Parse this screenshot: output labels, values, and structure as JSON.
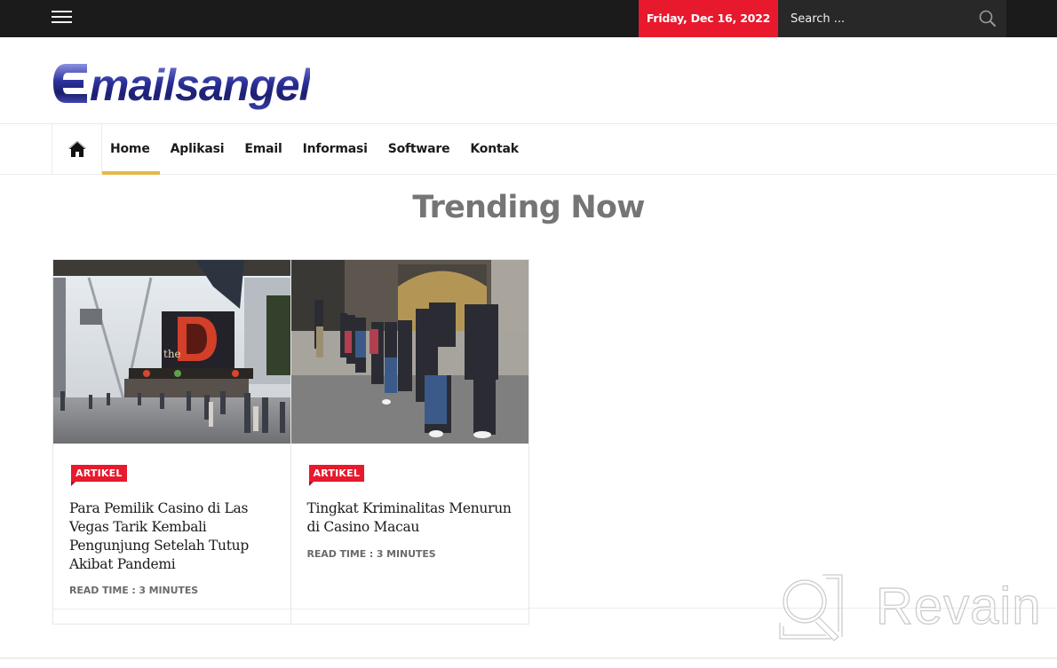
{
  "topbar": {
    "menu_icon": "hamburger-menu-icon",
    "date": "Friday, Dec 16, 2022",
    "search": {
      "placeholder": "Search ...",
      "value": "",
      "icon": "search-icon"
    },
    "colors": {
      "bar": "#1b1b1b",
      "date_bg": "#e8192c",
      "search_bg": "#282828"
    }
  },
  "header": {
    "logo_letter": "E",
    "logo_text": "mailsangel"
  },
  "nav": {
    "home_icon": "home-icon",
    "items": [
      {
        "label": "Home",
        "active": true
      },
      {
        "label": "Aplikasi",
        "active": false
      },
      {
        "label": "Email",
        "active": false
      },
      {
        "label": "Informasi",
        "active": false
      },
      {
        "label": "Software",
        "active": false
      },
      {
        "label": "Kontak",
        "active": false
      }
    ],
    "active_color": "#e5b94a"
  },
  "main": {
    "section_title": "Trending Now",
    "cards": [
      {
        "image_alt": "Las Vegas Fremont Street casino with The D sign",
        "category": "ARTIKEL",
        "title": "Para Pemilik Casino di Las Vegas Tarik Kembali Pengunjung Setelah Tutup Akibat Pandemi",
        "read_time": "READ TIME : 3 MINUTES"
      },
      {
        "image_alt": "Hooded suspects lined up outside a casino in Macau",
        "category": "ARTIKEL",
        "title": "Tingkat Kriminalitas Menurun di Casino Macau",
        "read_time": "READ TIME : 3 MINUTES"
      }
    ],
    "badge_color": "#e8192c"
  },
  "watermark": {
    "text": "Revain",
    "icon": "revain-logo-icon"
  }
}
